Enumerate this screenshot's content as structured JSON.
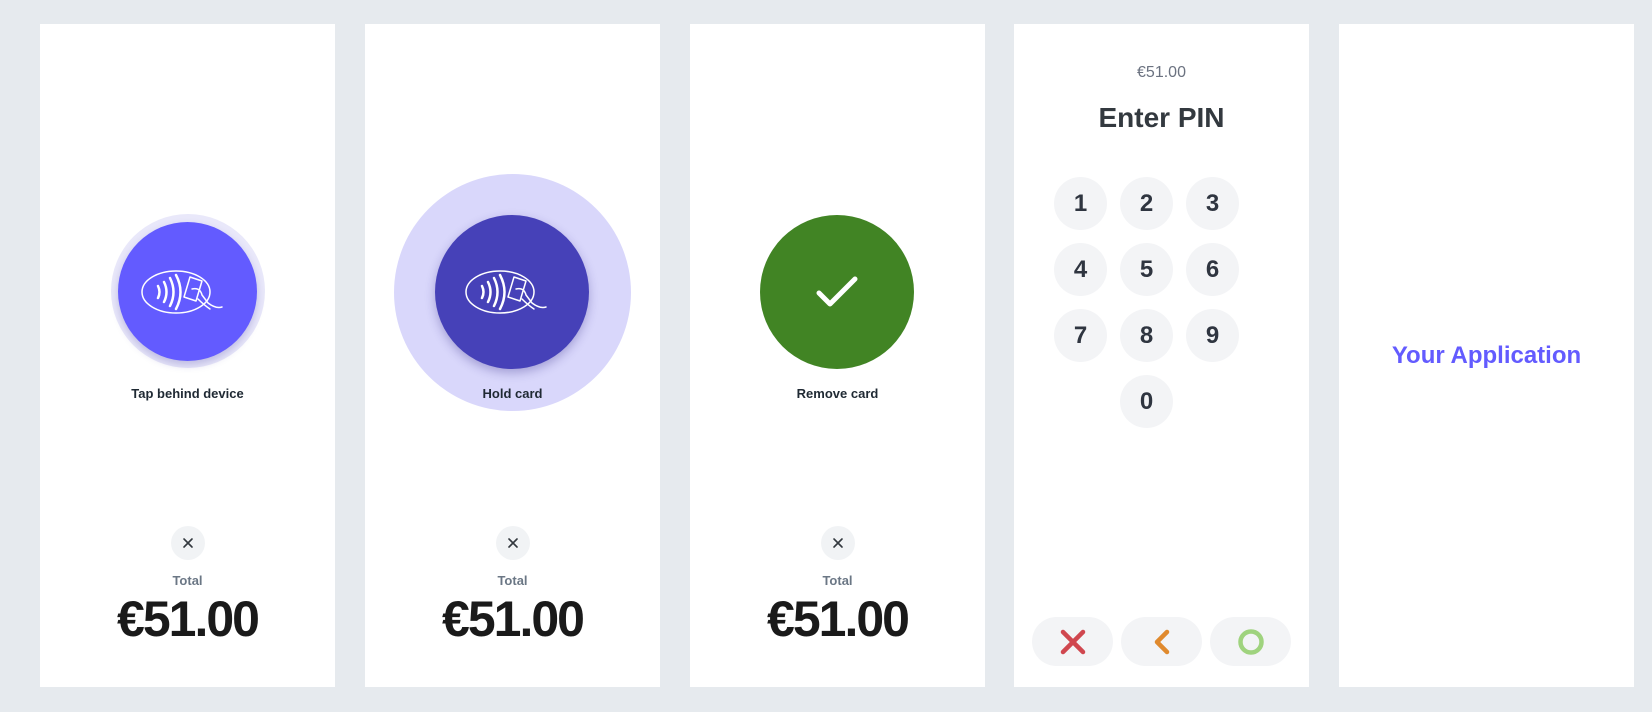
{
  "screens": [
    {
      "label": "Tap behind device",
      "total_label": "Total",
      "total_amount": "€51.00",
      "icon": "contactless-card-icon",
      "disc_color": "#635bff",
      "halo_color": "#e9e8fa"
    },
    {
      "label": "Hold card",
      "total_label": "Total",
      "total_amount": "€51.00",
      "icon": "contactless-card-icon",
      "disc_color": "#4641b8",
      "halo_color": "#d9d7fb"
    },
    {
      "label": "Remove card",
      "total_label": "Total",
      "total_amount": "€51.00",
      "icon": "checkmark-icon",
      "disc_color": "#418424"
    }
  ],
  "pin": {
    "amount": "€51.00",
    "title": "Enter PIN",
    "keys": [
      "1",
      "2",
      "3",
      "4",
      "5",
      "6",
      "7",
      "8",
      "9",
      "0"
    ],
    "actions": [
      {
        "icon": "cancel-x-icon",
        "color": "#d0474f"
      },
      {
        "icon": "backspace-chevron-icon",
        "color": "#e08a2e"
      },
      {
        "icon": "confirm-circle-icon",
        "color": "#9fd37e"
      }
    ]
  },
  "app": {
    "label": "Your Application",
    "accent": "#635bff"
  }
}
